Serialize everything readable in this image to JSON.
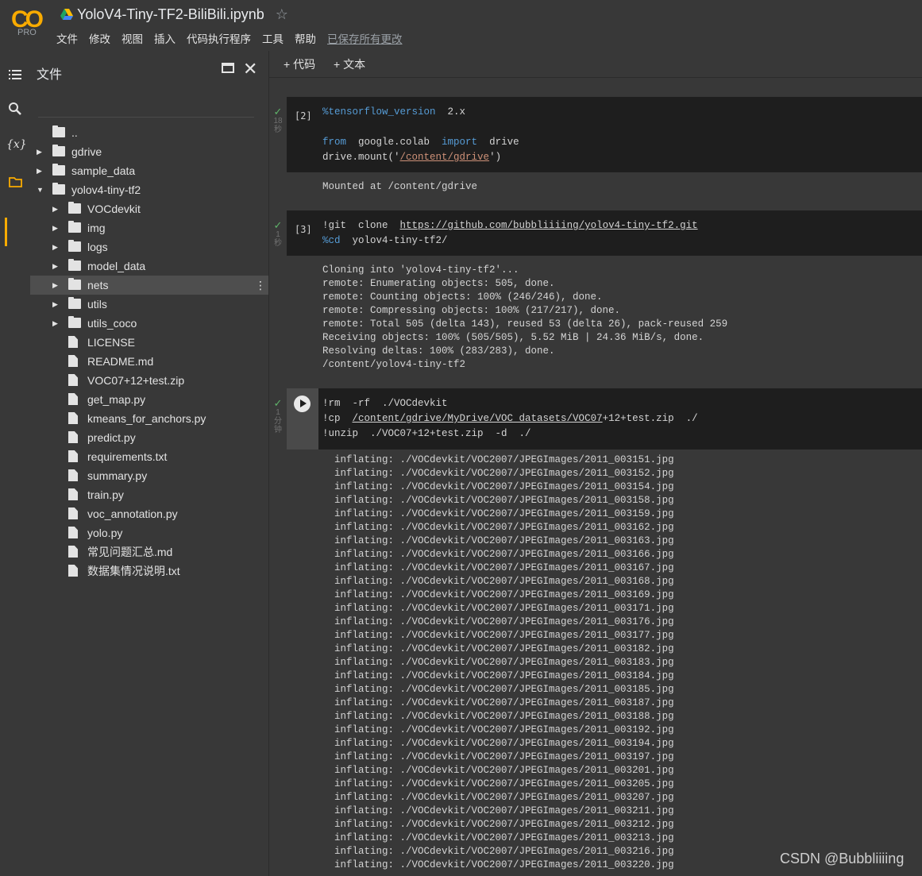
{
  "app": {
    "logo_text": "CO",
    "logo_badge": "PRO",
    "title": "YoloV4-Tiny-TF2-BiliBili.ipynb",
    "star": "☆"
  },
  "menu": [
    "文件",
    "修改",
    "视图",
    "插入",
    "代码执行程序",
    "工具",
    "帮助"
  ],
  "saved_status": "已保存所有更改",
  "files_panel": {
    "title": "文件",
    "tree": [
      {
        "label": "..",
        "type": "up",
        "depth": 0,
        "arrow": ""
      },
      {
        "label": "gdrive",
        "type": "folder",
        "depth": 0,
        "arrow": "right"
      },
      {
        "label": "sample_data",
        "type": "folder",
        "depth": 0,
        "arrow": "right"
      },
      {
        "label": "yolov4-tiny-tf2",
        "type": "folder",
        "depth": 0,
        "arrow": "down"
      },
      {
        "label": "VOCdevkit",
        "type": "folder",
        "depth": 1,
        "arrow": "right"
      },
      {
        "label": "img",
        "type": "folder",
        "depth": 1,
        "arrow": "right"
      },
      {
        "label": "logs",
        "type": "folder",
        "depth": 1,
        "arrow": "right"
      },
      {
        "label": "model_data",
        "type": "folder",
        "depth": 1,
        "arrow": "right"
      },
      {
        "label": "nets",
        "type": "folder",
        "depth": 1,
        "arrow": "right",
        "selected": true
      },
      {
        "label": "utils",
        "type": "folder",
        "depth": 1,
        "arrow": "right"
      },
      {
        "label": "utils_coco",
        "type": "folder",
        "depth": 1,
        "arrow": "right"
      },
      {
        "label": "LICENSE",
        "type": "file",
        "depth": 1,
        "arrow": ""
      },
      {
        "label": "README.md",
        "type": "file",
        "depth": 1,
        "arrow": ""
      },
      {
        "label": "VOC07+12+test.zip",
        "type": "file",
        "depth": 1,
        "arrow": ""
      },
      {
        "label": "get_map.py",
        "type": "file",
        "depth": 1,
        "arrow": ""
      },
      {
        "label": "kmeans_for_anchors.py",
        "type": "file",
        "depth": 1,
        "arrow": ""
      },
      {
        "label": "predict.py",
        "type": "file",
        "depth": 1,
        "arrow": ""
      },
      {
        "label": "requirements.txt",
        "type": "file",
        "depth": 1,
        "arrow": ""
      },
      {
        "label": "summary.py",
        "type": "file",
        "depth": 1,
        "arrow": ""
      },
      {
        "label": "train.py",
        "type": "file",
        "depth": 1,
        "arrow": ""
      },
      {
        "label": "voc_annotation.py",
        "type": "file",
        "depth": 1,
        "arrow": ""
      },
      {
        "label": "yolo.py",
        "type": "file",
        "depth": 1,
        "arrow": ""
      },
      {
        "label": "常见问题汇总.md",
        "type": "file",
        "depth": 1,
        "arrow": ""
      },
      {
        "label": "数据集情况说明.txt",
        "type": "file",
        "depth": 1,
        "arrow": ""
      }
    ]
  },
  "toolbar": {
    "add_code": "+ 代码",
    "add_text": "+ 文本"
  },
  "cells": [
    {
      "exec": "[2]",
      "status_check": "✓",
      "duration": [
        "18",
        "秒"
      ],
      "code_lines": [
        [
          {
            "t": "%tensorflow_version",
            "c": "magic"
          },
          {
            "t": "  2.x",
            "c": ""
          }
        ],
        [
          {
            "t": "",
            "c": ""
          }
        ],
        [
          {
            "t": "from",
            "c": "kw"
          },
          {
            "t": "  google.colab  ",
            "c": ""
          },
          {
            "t": "import",
            "c": "kw"
          },
          {
            "t": "  drive",
            "c": ""
          }
        ],
        [
          {
            "t": "drive.mount('",
            "c": ""
          },
          {
            "t": "/content/gdrive",
            "c": "str"
          },
          {
            "t": "')",
            "c": ""
          }
        ]
      ],
      "output": [
        "Mounted at /content/gdrive"
      ]
    },
    {
      "exec": "[3]",
      "status_check": "✓",
      "duration": [
        "1",
        "秒"
      ],
      "code_lines": [
        [
          {
            "t": "!git  clone  ",
            "c": ""
          },
          {
            "t": "https://github.com/bubbliiiing/yolov4-tiny-tf2.git",
            "c": "url"
          }
        ],
        [
          {
            "t": "%cd",
            "c": "magic"
          },
          {
            "t": "  yolov4-tiny-tf2/",
            "c": ""
          }
        ]
      ],
      "output": [
        "Cloning into 'yolov4-tiny-tf2'...",
        "remote: Enumerating objects: 505, done.",
        "remote: Counting objects: 100% (246/246), done.",
        "remote: Compressing objects: 100% (217/217), done.",
        "remote: Total 505 (delta 143), reused 53 (delta 26), pack-reused 259",
        "Receiving objects: 100% (505/505), 5.52 MiB | 24.36 MiB/s, done.",
        "Resolving deltas: 100% (283/283), done.",
        "/content/yolov4-tiny-tf2"
      ]
    },
    {
      "exec": "",
      "status_check": "✓",
      "duration": [
        "1",
        "分",
        "钟"
      ],
      "code_lines": [
        [
          {
            "t": "!rm  -rf  ./VOCdevkit",
            "c": ""
          }
        ],
        [
          {
            "t": "!cp  ",
            "c": ""
          },
          {
            "t": "/content/gdrive/MyDrive/VOC_datasets/VOC07",
            "c": "url"
          },
          {
            "t": "+12+test.zip  ./",
            "c": ""
          }
        ],
        [
          {
            "t": "!unzip  ./VOC07+12+test.zip  -d  ./",
            "c": ""
          }
        ]
      ],
      "output": [
        "  inflating: ./VOCdevkit/VOC2007/JPEGImages/2011_003151.jpg",
        "  inflating: ./VOCdevkit/VOC2007/JPEGImages/2011_003152.jpg",
        "  inflating: ./VOCdevkit/VOC2007/JPEGImages/2011_003154.jpg",
        "  inflating: ./VOCdevkit/VOC2007/JPEGImages/2011_003158.jpg",
        "  inflating: ./VOCdevkit/VOC2007/JPEGImages/2011_003159.jpg",
        "  inflating: ./VOCdevkit/VOC2007/JPEGImages/2011_003162.jpg",
        "  inflating: ./VOCdevkit/VOC2007/JPEGImages/2011_003163.jpg",
        "  inflating: ./VOCdevkit/VOC2007/JPEGImages/2011_003166.jpg",
        "  inflating: ./VOCdevkit/VOC2007/JPEGImages/2011_003167.jpg",
        "  inflating: ./VOCdevkit/VOC2007/JPEGImages/2011_003168.jpg",
        "  inflating: ./VOCdevkit/VOC2007/JPEGImages/2011_003169.jpg",
        "  inflating: ./VOCdevkit/VOC2007/JPEGImages/2011_003171.jpg",
        "  inflating: ./VOCdevkit/VOC2007/JPEGImages/2011_003176.jpg",
        "  inflating: ./VOCdevkit/VOC2007/JPEGImages/2011_003177.jpg",
        "  inflating: ./VOCdevkit/VOC2007/JPEGImages/2011_003182.jpg",
        "  inflating: ./VOCdevkit/VOC2007/JPEGImages/2011_003183.jpg",
        "  inflating: ./VOCdevkit/VOC2007/JPEGImages/2011_003184.jpg",
        "  inflating: ./VOCdevkit/VOC2007/JPEGImages/2011_003185.jpg",
        "  inflating: ./VOCdevkit/VOC2007/JPEGImages/2011_003187.jpg",
        "  inflating: ./VOCdevkit/VOC2007/JPEGImages/2011_003188.jpg",
        "  inflating: ./VOCdevkit/VOC2007/JPEGImages/2011_003192.jpg",
        "  inflating: ./VOCdevkit/VOC2007/JPEGImages/2011_003194.jpg",
        "  inflating: ./VOCdevkit/VOC2007/JPEGImages/2011_003197.jpg",
        "  inflating: ./VOCdevkit/VOC2007/JPEGImages/2011_003201.jpg",
        "  inflating: ./VOCdevkit/VOC2007/JPEGImages/2011_003205.jpg",
        "  inflating: ./VOCdevkit/VOC2007/JPEGImages/2011_003207.jpg",
        "  inflating: ./VOCdevkit/VOC2007/JPEGImages/2011_003211.jpg",
        "  inflating: ./VOCdevkit/VOC2007/JPEGImages/2011_003212.jpg",
        "  inflating: ./VOCdevkit/VOC2007/JPEGImages/2011_003213.jpg",
        "  inflating: ./VOCdevkit/VOC2007/JPEGImages/2011_003216.jpg",
        "  inflating: ./VOCdevkit/VOC2007/JPEGImages/2011_003220.jpg"
      ]
    }
  ],
  "watermark": "CSDN @Bubbliiiing",
  "colors": {
    "accent": "#f9ab00",
    "check": "#5fb36a",
    "bg": "#383838",
    "cell_bg": "#1e1e1e"
  }
}
